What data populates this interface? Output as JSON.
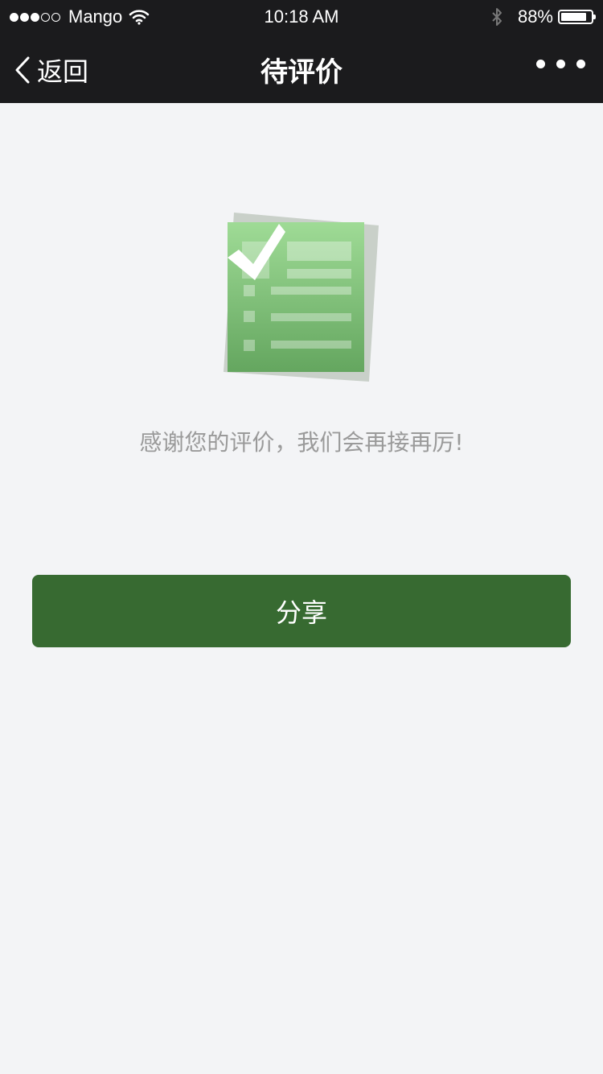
{
  "status_bar": {
    "signal_filled": 3,
    "signal_total": 5,
    "carrier": "Mango",
    "time": "10:18 AM",
    "battery_percent": "88%",
    "battery_level": 0.88,
    "icons": [
      "wifi-icon",
      "bluetooth-icon",
      "battery-icon"
    ]
  },
  "nav": {
    "back_label": "返回",
    "title": "待评价",
    "icons": [
      "chevron-left-icon",
      "more-icon"
    ]
  },
  "content": {
    "illustration_icon": "checklist-icon",
    "message": "感谢您的评价，我们会再接再厉!",
    "share_label": "分享"
  },
  "colors": {
    "bar_background": "#1b1b1d",
    "page_background": "#f3f4f6",
    "button_green": "#376a31",
    "message_gray": "#9a9a9a"
  }
}
